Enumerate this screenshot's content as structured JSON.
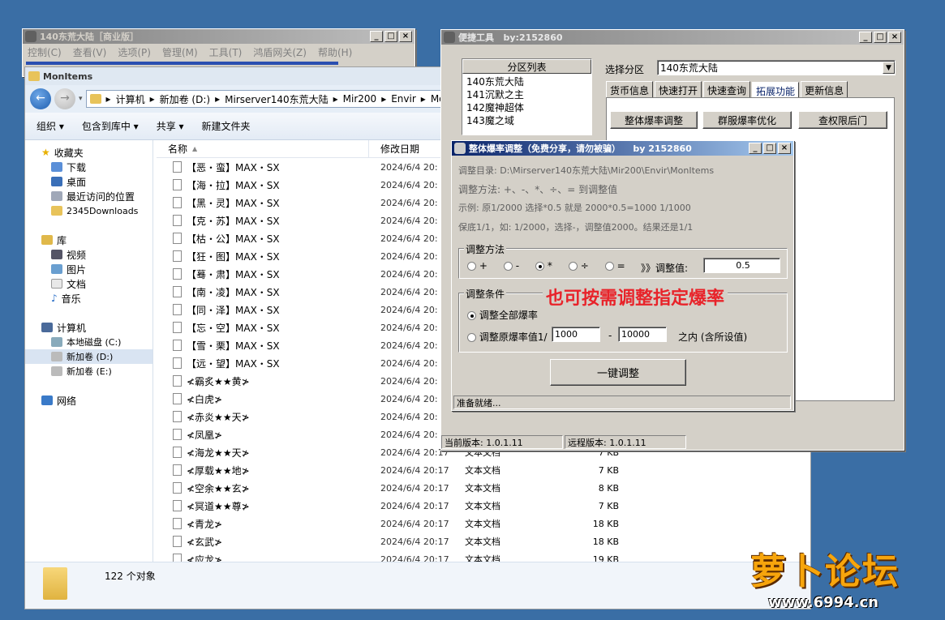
{
  "bg_window": {
    "title": "140东荒大陆［商业版］",
    "menu": [
      "控制(C)",
      "查看(V)",
      "选项(P)",
      "管理(M)",
      "工具(T)",
      "鸿盾网关(Z)",
      "帮助(H)"
    ]
  },
  "explorer": {
    "title": "MonItems",
    "breadcrumb": [
      "计算机",
      "新加卷 (D:)",
      "Mirserver140东荒大陆",
      "Mir200",
      "Envir",
      "MonI"
    ],
    "toolbar": [
      "组织 ▾",
      "包含到库中 ▾",
      "共享 ▾",
      "新建文件夹"
    ],
    "nav": {
      "favorites": "收藏夹",
      "fav_items": [
        "下载",
        "桌面",
        "最近访问的位置",
        "2345Downloads"
      ],
      "libraries": "库",
      "lib_items": [
        "视频",
        "图片",
        "文档",
        "音乐"
      ],
      "computer": "计算机",
      "drives": [
        "本地磁盘 (C:)",
        "新加卷 (D:)",
        "新加卷 (E:)"
      ],
      "network": "网络"
    },
    "columns": {
      "name": "名称",
      "date": "修改日期"
    },
    "files": [
      {
        "name": "【恶・蛮】MAX・SX",
        "date": "2024/6/4 20:",
        "type": "",
        "size": ""
      },
      {
        "name": "【海・拉】MAX・SX",
        "date": "2024/6/4 20:",
        "type": "",
        "size": ""
      },
      {
        "name": "【黑・灵】MAX・SX",
        "date": "2024/6/4 20:",
        "type": "",
        "size": ""
      },
      {
        "name": "【克・苏】MAX・SX",
        "date": "2024/6/4 20:",
        "type": "",
        "size": ""
      },
      {
        "name": "【枯・公】MAX・SX",
        "date": "2024/6/4 20:",
        "type": "",
        "size": ""
      },
      {
        "name": "【狂・图】MAX・SX",
        "date": "2024/6/4 20:",
        "type": "",
        "size": ""
      },
      {
        "name": "【蓦・肃】MAX・SX",
        "date": "2024/6/4 20:",
        "type": "",
        "size": ""
      },
      {
        "name": "【南・凌】MAX・SX",
        "date": "2024/6/4 20:",
        "type": "",
        "size": ""
      },
      {
        "name": "【同・泽】MAX・SX",
        "date": "2024/6/4 20:",
        "type": "",
        "size": ""
      },
      {
        "name": "【忘・空】MAX・SX",
        "date": "2024/6/4 20:",
        "type": "",
        "size": ""
      },
      {
        "name": "【雪・栗】MAX・SX",
        "date": "2024/6/4 20:",
        "type": "",
        "size": ""
      },
      {
        "name": "【远・望】MAX・SX",
        "date": "2024/6/4 20:",
        "type": "",
        "size": ""
      },
      {
        "name": "≮霸炙★★黄≯",
        "date": "2024/6/4 20:",
        "type": "",
        "size": ""
      },
      {
        "name": "≮白虎≯",
        "date": "2024/6/4 20:",
        "type": "",
        "size": ""
      },
      {
        "name": "≮赤炎★★天≯",
        "date": "2024/6/4 20:",
        "type": "",
        "size": ""
      },
      {
        "name": "≮凤凰≯",
        "date": "2024/6/4 20:",
        "type": "",
        "size": ""
      },
      {
        "name": "≮海龙★★天≯",
        "date": "2024/6/4 20:17",
        "type": "文本文档",
        "size": "7 KB"
      },
      {
        "name": "≮厚载★★地≯",
        "date": "2024/6/4 20:17",
        "type": "文本文档",
        "size": "7 KB"
      },
      {
        "name": "≮空余★★玄≯",
        "date": "2024/6/4 20:17",
        "type": "文本文档",
        "size": "8 KB"
      },
      {
        "name": "≮冥道★★尊≯",
        "date": "2024/6/4 20:17",
        "type": "文本文档",
        "size": "7 KB"
      },
      {
        "name": "≮青龙≯",
        "date": "2024/6/4 20:17",
        "type": "文本文档",
        "size": "18 KB"
      },
      {
        "name": "≮玄武≯",
        "date": "2024/6/4 20:17",
        "type": "文本文档",
        "size": "18 KB"
      },
      {
        "name": "≮应龙≯",
        "date": "2024/6/4 20:17",
        "type": "文本文档",
        "size": "19 KB"
      }
    ],
    "status_count": "122 个对象"
  },
  "tool": {
    "title": "便捷工具",
    "by": "by:2152860",
    "partition_list_title": "分区列表",
    "partitions": [
      "140东荒大陆",
      "141沉默之主",
      "142魔神超体",
      "143魔之域"
    ],
    "select_label": "选择分区",
    "selected_partition": "140东荒大陆",
    "tabs": [
      "货币信息",
      "快速打开",
      "快速查询",
      "拓展功能",
      "更新信息"
    ],
    "active_tab": 3,
    "buttons": [
      "整体爆率调整",
      "群服爆率优化",
      "查权限后门"
    ],
    "current_version": "当前版本: 1.0.1.11",
    "remote_version": "远程版本: 1.0.1.11"
  },
  "dialog": {
    "title": "整体爆率调整（免费分享，请勿被骗）",
    "by": "by 2152860",
    "dir_line": "调整目录: D:\\Mirserver140东荒大陆\\Mir200\\Envir\\MonItems",
    "method_line": "调整方法: +、-、*、÷、=   到调整值",
    "example_line": "示例: 原1/2000 选择*0.5 就是 2000*0.5=1000  1/1000",
    "keep_line": "保底1/1，如: 1/2000，选择-，调整值2000。结果还是1/1",
    "method_group": "调整方法",
    "methods": [
      "+",
      "-",
      "*",
      "÷",
      "="
    ],
    "selected_method": 2,
    "adjust_value_label": "》》调整值:",
    "adjust_value": "0.5",
    "cond_group": "调整条件",
    "cond_all": "调整全部爆率",
    "cond_range": "调整原爆率值1/",
    "range_from": "1000",
    "range_dash": "-",
    "range_to": "10000",
    "range_suffix": "之内 (含所设值)",
    "overlay_text": "也可按需调整指定爆率",
    "apply_button": "一键调整",
    "status": "准备就绪..."
  },
  "watermark": {
    "brand": "萝卜论坛",
    "url": "www.6994.cn"
  },
  "colors": {
    "overlay": "#e8232a",
    "titlebar_active": "#0a246a",
    "desktop": "#3a6ea5"
  }
}
